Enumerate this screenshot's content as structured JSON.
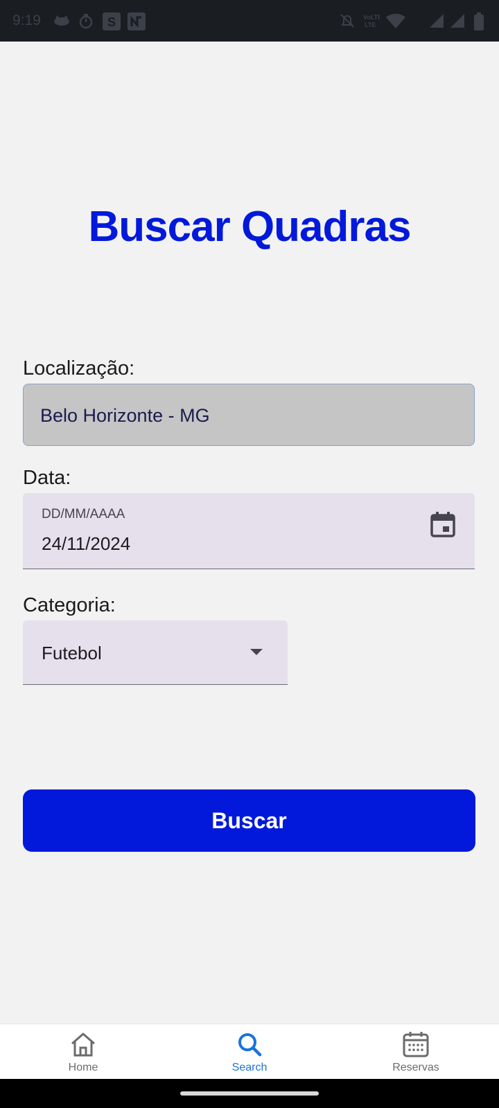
{
  "status_bar": {
    "time": "9:19",
    "icons": [
      "cat-icon",
      "timer-icon",
      "s-app-icon",
      "n-app-icon",
      "mute-icon",
      "volte-icon",
      "wifi-icon",
      "signal-icon",
      "signal-icon",
      "battery-icon"
    ]
  },
  "page": {
    "title": "Buscar Quadras"
  },
  "form": {
    "location_label": "Localização:",
    "location_value": "Belo Horizonte - MG",
    "date_label": "Data:",
    "date_placeholder": "DD/MM/AAAA",
    "date_value": "24/11/2024",
    "category_label": "Categoria:",
    "category_value": "Futebol",
    "search_button": "Buscar"
  },
  "bottom_nav": {
    "items": [
      {
        "label": "Home",
        "icon": "home-icon",
        "active": false
      },
      {
        "label": "Search",
        "icon": "search-icon",
        "active": true
      },
      {
        "label": "Reservas",
        "icon": "calendar-icon",
        "active": false
      }
    ]
  },
  "colors": {
    "primary": "#0219db",
    "nav_active": "#1a73d9",
    "nav_inactive": "#6b6b6b",
    "field_bg": "#e6dfec",
    "location_bg": "#c5c5c6"
  }
}
